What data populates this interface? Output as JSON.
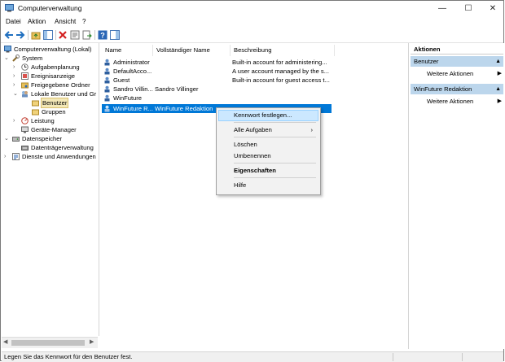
{
  "window": {
    "title": "Computerverwaltung",
    "controls": {
      "minimize": "—",
      "maximize": "☐",
      "close": "✕"
    }
  },
  "menubar": {
    "items": [
      "Datei",
      "Aktion",
      "Ansicht",
      "?"
    ]
  },
  "toolbar": {
    "icons": [
      "back-icon",
      "forward-icon",
      "up-folder-icon",
      "show-hide-tree-icon",
      "delete-icon",
      "properties-icon",
      "export-list-icon",
      "help-icon",
      "show-hide-action-pane-icon"
    ]
  },
  "tree": {
    "items": [
      {
        "label": "Computerverwaltung (Lokal)",
        "expander": ""
      },
      {
        "label": "System",
        "expander": "⌄"
      },
      {
        "label": "Aufgabenplanung",
        "expander": "›"
      },
      {
        "label": "Ereignisanzeige",
        "expander": "›"
      },
      {
        "label": "Freigegebene Ordner",
        "expander": "›"
      },
      {
        "label": "Lokale Benutzer und Gr",
        "expander": "⌄"
      },
      {
        "label": "Benutzer",
        "expander": ""
      },
      {
        "label": "Gruppen",
        "expander": ""
      },
      {
        "label": "Leistung",
        "expander": "›"
      },
      {
        "label": "Geräte-Manager",
        "expander": ""
      },
      {
        "label": "Datenspeicher",
        "expander": "⌄"
      },
      {
        "label": "Datenträgerverwaltung",
        "expander": ""
      },
      {
        "label": "Dienste und Anwendungen",
        "expander": "›"
      }
    ]
  },
  "list": {
    "columns": [
      "Name",
      "Vollständiger Name",
      "Beschreibung"
    ],
    "rows": [
      {
        "name": "Administrator",
        "full_name": "",
        "description": "Built-in account for administering..."
      },
      {
        "name": "DefaultAcco...",
        "full_name": "",
        "description": "A user account managed by the s..."
      },
      {
        "name": "Guest",
        "full_name": "",
        "description": "Built-in account for guest access t..."
      },
      {
        "name": "Sandro Villin...",
        "full_name": "Sandro Villinger",
        "description": ""
      },
      {
        "name": "WinFuture",
        "full_name": "",
        "description": ""
      },
      {
        "name": "WinFuture R...",
        "full_name": "WinFuture Redaktion",
        "description": ""
      }
    ]
  },
  "context_menu": {
    "set_password": "Kennwort festlegen...",
    "all_tasks": "Alle Aufgaben",
    "all_tasks_arrow": "›",
    "delete": "Löschen",
    "rename": "Umbenennen",
    "properties": "Eigenschaften",
    "help": "Hilfe"
  },
  "actions_pane": {
    "header": "Aktionen",
    "sections": [
      {
        "title": "Benutzer",
        "collapse": "▲",
        "item": "Weitere Aktionen",
        "arrow": "▶"
      },
      {
        "title": "WinFuture Redaktion",
        "collapse": "▲",
        "item": "Weitere Aktionen",
        "arrow": "▶"
      }
    ]
  },
  "scrollbar": {
    "left": "◀",
    "right": "▶"
  },
  "status": {
    "text": "Legen Sie das Kennwort für den Benutzer fest."
  },
  "colors": {
    "selection": "#0078d7",
    "section_header": "#bcd6ec",
    "menu_highlight": "#cce8ff"
  }
}
